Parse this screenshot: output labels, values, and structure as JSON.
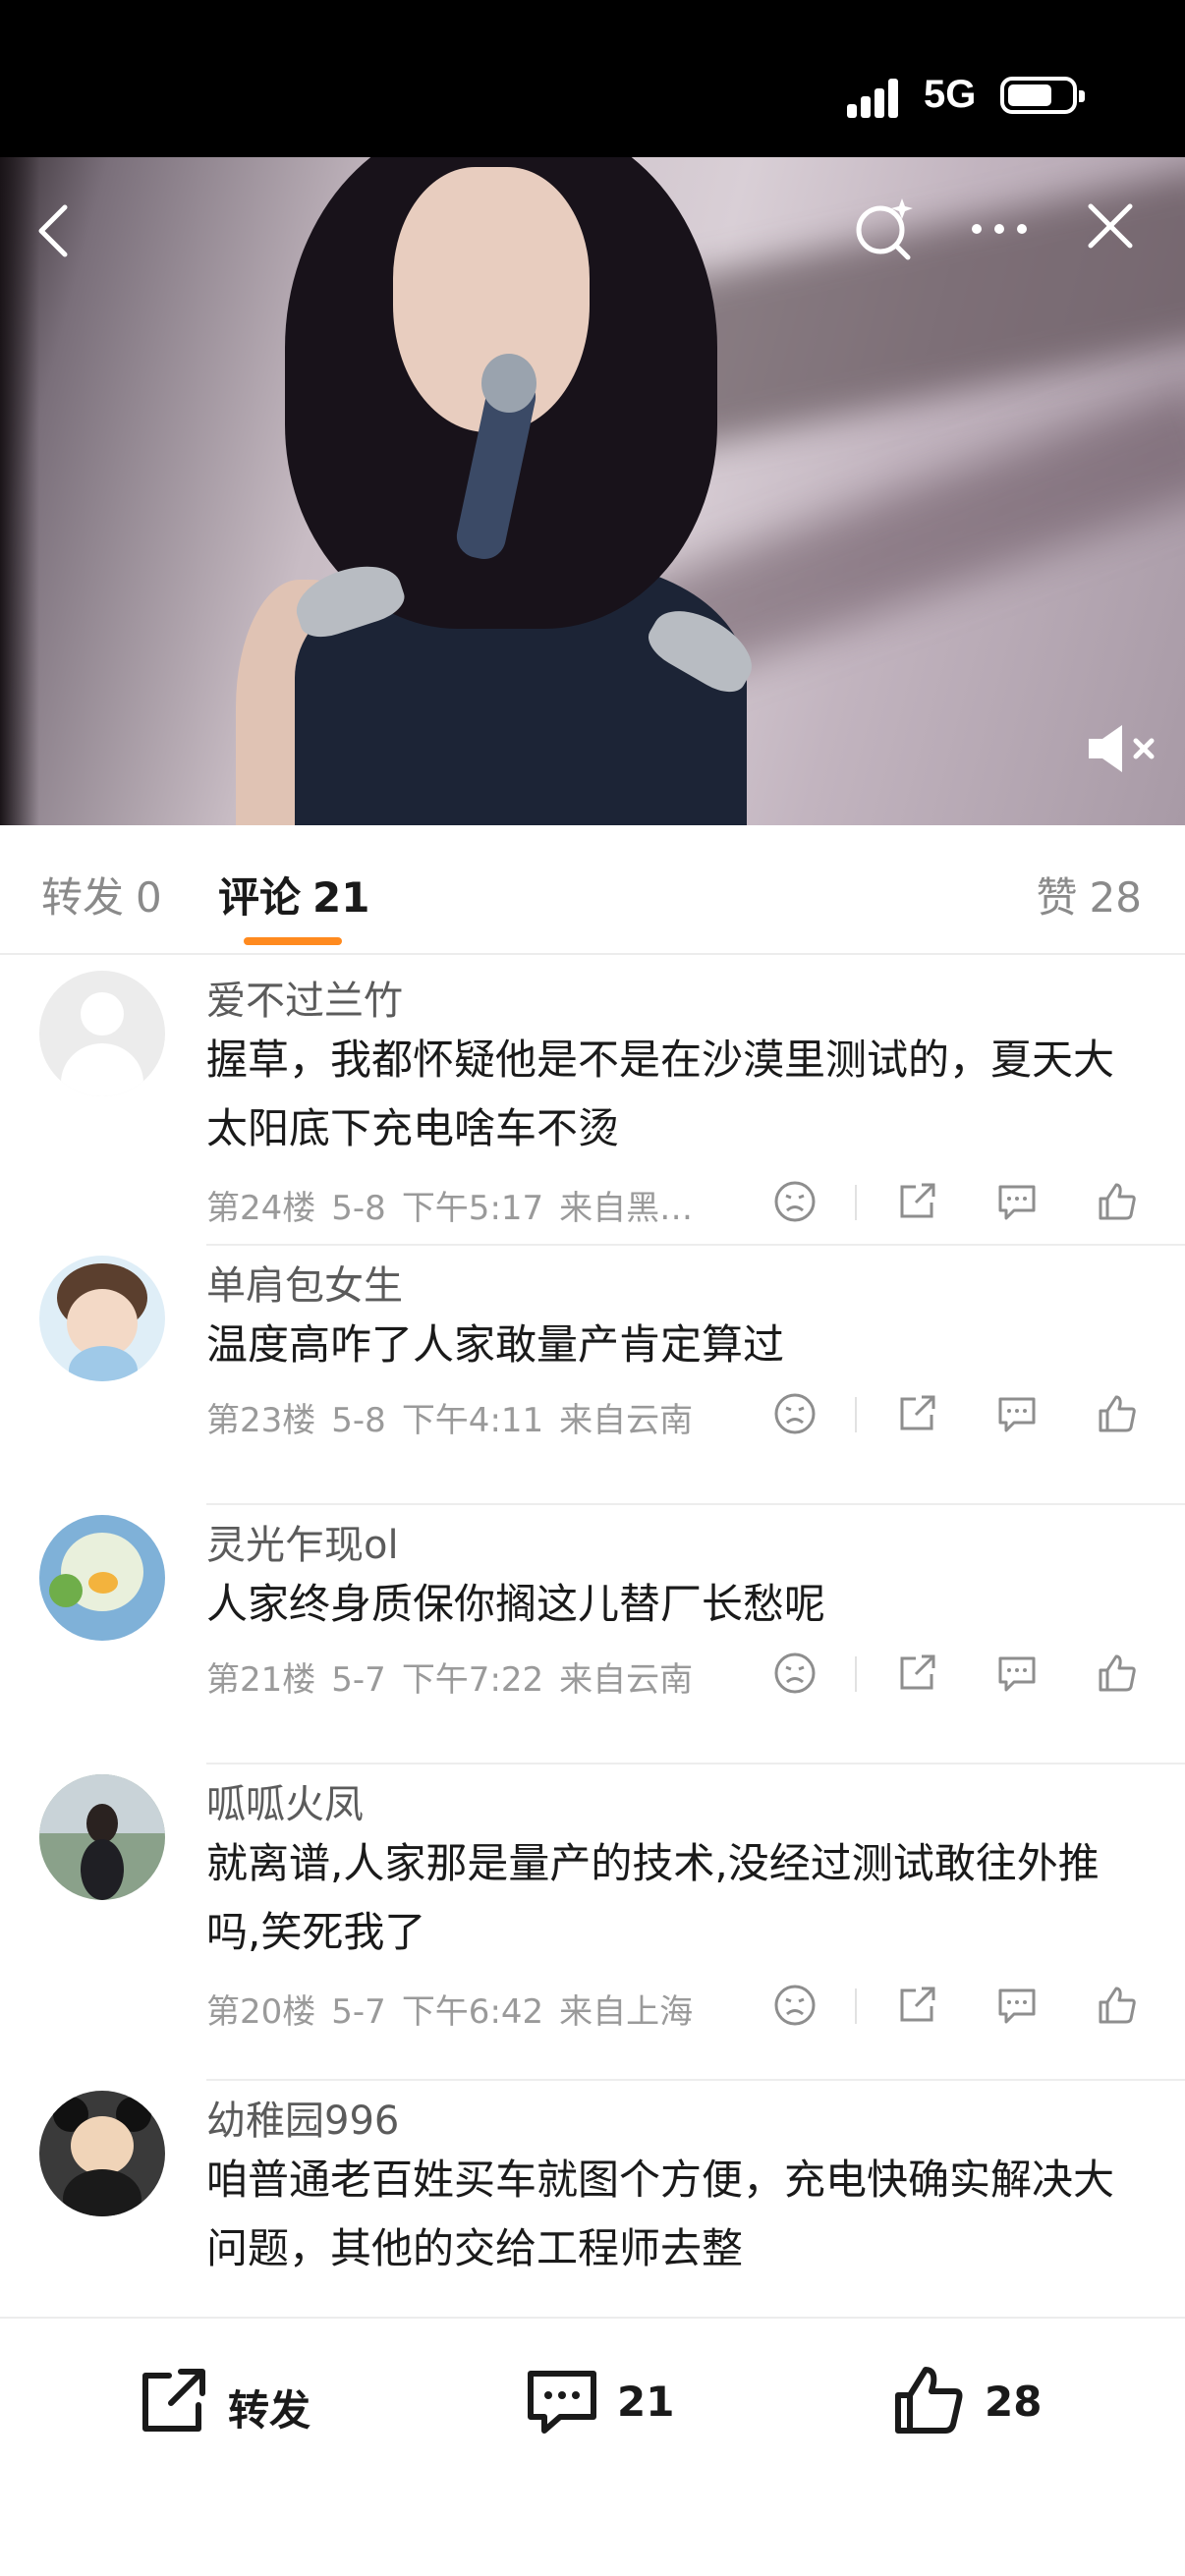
{
  "status_bar": {
    "network": "5G",
    "icons": [
      "signal-icon",
      "battery-icon"
    ]
  },
  "video": {
    "icons": [
      "back-icon",
      "search-star-icon",
      "more-icon",
      "close-icon",
      "mute-icon"
    ]
  },
  "tabs": {
    "repost": {
      "label": "转发",
      "count": "0"
    },
    "comment": {
      "label": "评论",
      "count": "21"
    },
    "likes": {
      "label": "赞",
      "count": "28"
    }
  },
  "comments": [
    {
      "user": "爱不过兰竹",
      "text": "握草，我都怀疑他是不是在沙漠里测试的，夏天大太阳底下充电啥车不烫",
      "floor": "第24楼",
      "date": "5-8",
      "time": "下午5:17",
      "location": "来自黑…"
    },
    {
      "user": "单肩包女生",
      "text": "温度高咋了人家敢量产肯定算过",
      "floor": "第23楼",
      "date": "5-8",
      "time": "下午4:11",
      "location": "来自云南"
    },
    {
      "user": "灵光乍现ol",
      "text": "人家终身质保你搁这儿替厂长愁呢",
      "floor": "第21楼",
      "date": "5-7",
      "time": "下午7:22",
      "location": "来自云南"
    },
    {
      "user": "呱呱火凤",
      "text": "就离谱,人家那是量产的技术,没经过测试敢往外推吗,笑死我了",
      "floor": "第20楼",
      "date": "5-7",
      "time": "下午6:42",
      "location": "来自上海"
    },
    {
      "user": "幼稚园996",
      "text": "咱普通老百姓买车就图个方便，充电快确实解决大问题，其他的交给工程师去整",
      "floor": "",
      "date": "",
      "time": "",
      "location": ""
    }
  ],
  "bottom_bar": {
    "repost_label": "转发",
    "comment_count": "21",
    "like_count": "28"
  },
  "colors": {
    "accent": "#ff8a1f",
    "text": "#1a1a1a",
    "muted": "#9a9a9a"
  }
}
